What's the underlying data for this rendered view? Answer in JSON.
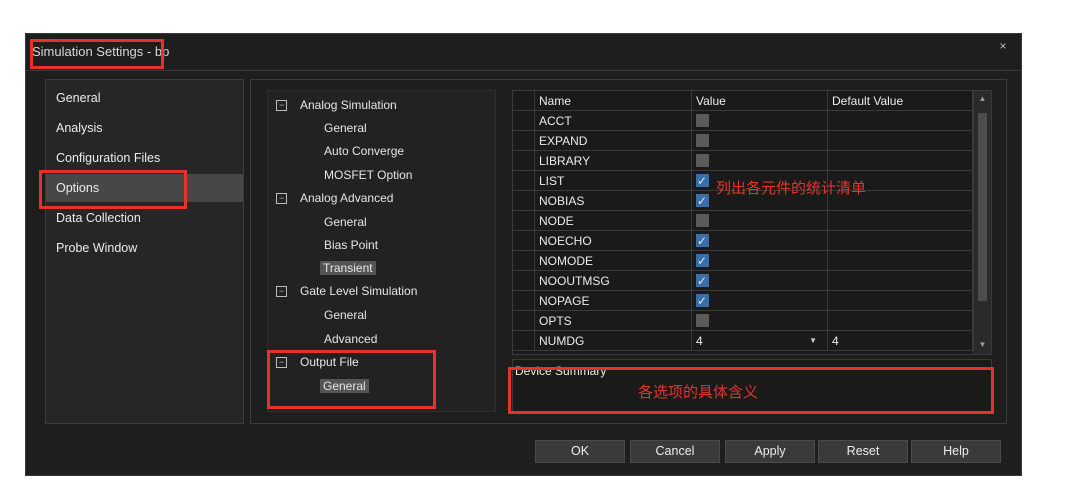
{
  "window": {
    "title": "Simulation Settings - bp",
    "close_glyph": "×"
  },
  "nav": {
    "items": [
      {
        "label": "General"
      },
      {
        "label": "Analysis"
      },
      {
        "label": "Configuration Files"
      },
      {
        "label": "Options",
        "selected": true
      },
      {
        "label": "Data Collection"
      },
      {
        "label": "Probe Window"
      }
    ]
  },
  "tree": {
    "collapse_glyph": "−",
    "nodes": [
      {
        "label": "Analog Simulation",
        "level": 0,
        "expander": true
      },
      {
        "label": "General",
        "level": 1
      },
      {
        "label": "Auto Converge",
        "level": 1
      },
      {
        "label": "MOSFET Option",
        "level": 1
      },
      {
        "label": "Analog Advanced",
        "level": 0,
        "expander": true
      },
      {
        "label": "General",
        "level": 1
      },
      {
        "label": "Bias Point",
        "level": 1
      },
      {
        "label": "Transient",
        "level": 1,
        "selected": true
      },
      {
        "label": "Gate Level Simulation",
        "level": 0,
        "expander": true
      },
      {
        "label": "General",
        "level": 1
      },
      {
        "label": "Advanced",
        "level": 1
      },
      {
        "label": "Output File",
        "level": 0,
        "expander": true
      },
      {
        "label": "General",
        "level": 1,
        "selected": true
      }
    ]
  },
  "grid": {
    "headers": [
      "Name",
      "Value",
      "Default Value"
    ],
    "rows": [
      {
        "name": "ACCT",
        "checked": false
      },
      {
        "name": "EXPAND",
        "checked": false
      },
      {
        "name": "LIBRARY",
        "checked": false
      },
      {
        "name": "LIST",
        "checked": true
      },
      {
        "name": "NOBIAS",
        "checked": true
      },
      {
        "name": "NODE",
        "checked": false
      },
      {
        "name": "NOECHO",
        "checked": true
      },
      {
        "name": "NOMODE",
        "checked": true
      },
      {
        "name": "NOOUTMSG",
        "checked": true
      },
      {
        "name": "NOPAGE",
        "checked": true
      },
      {
        "name": "OPTS",
        "checked": false
      },
      {
        "name": "NUMDG",
        "value": "4",
        "default": "4",
        "dropdown": true
      }
    ],
    "dropdown_glyph": "▼",
    "scroll_up_glyph": "▲",
    "scroll_down_glyph": "▼"
  },
  "description": {
    "label": "Device Summary"
  },
  "annotations": {
    "list_note": "列出各元件的统计清单",
    "desc_note": "各选项的具体含义",
    "highlight_color": "#e5322a"
  },
  "buttons": {
    "ok": "OK",
    "cancel": "Cancel",
    "apply": "Apply",
    "reset": "Reset",
    "help": "Help"
  },
  "colors": {
    "background": "#1e1e1e",
    "selected": "#474747",
    "checkbox_on": "#3a6ea5",
    "checkbox_off": "#5a5a5a"
  }
}
